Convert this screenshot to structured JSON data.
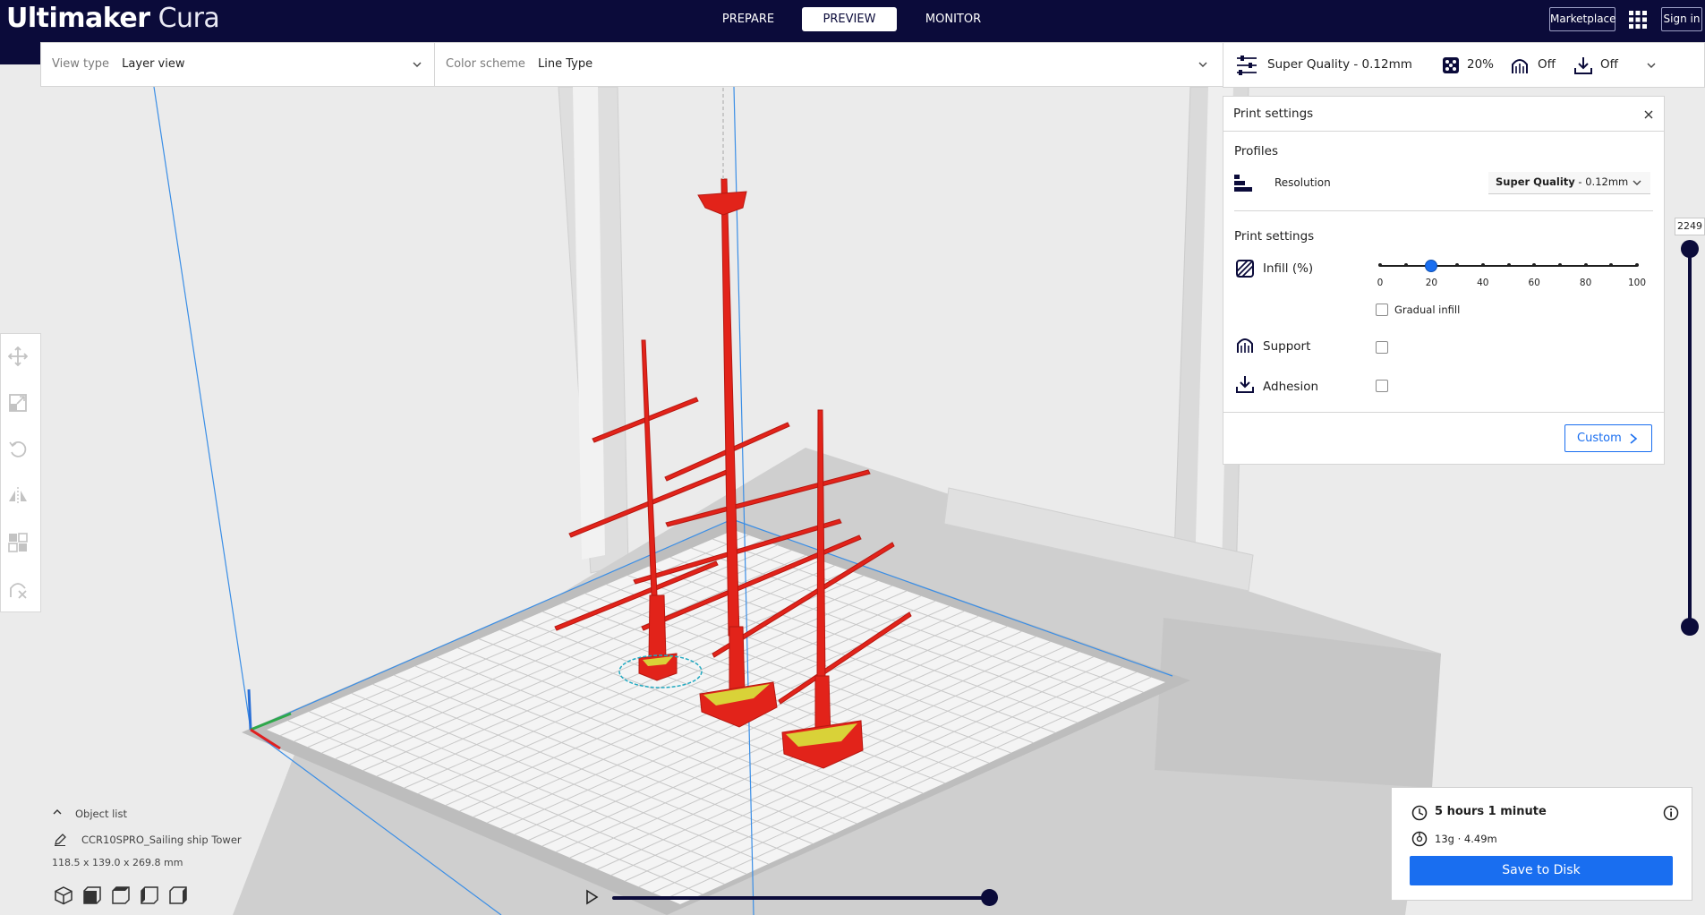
{
  "app": {
    "name_bold": "Ultimaker",
    "name_thin": "Cura"
  },
  "stages": [
    {
      "label": "PREPARE"
    },
    {
      "label": "PREVIEW"
    },
    {
      "label": "MONITOR"
    }
  ],
  "header_buttons": {
    "marketplace": "Marketplace",
    "signin": "Sign in"
  },
  "view": {
    "view_type_label": "View type",
    "view_type_value": "Layer view",
    "color_scheme_label": "Color scheme",
    "color_scheme_value": "Line Type"
  },
  "print_header": {
    "profile": "Super Quality - 0.12mm",
    "infill": "20%",
    "support": "Off",
    "adhesion": "Off"
  },
  "print_settings": {
    "title": "Print settings",
    "profiles_heading": "Profiles",
    "resolution_label": "Resolution",
    "resolution_bold": "Super Quality",
    "resolution_rest": " - 0.12mm",
    "settings_heading": "Print settings",
    "infill_label": "Infill (%)",
    "infill_value": 20,
    "infill_ticks": [
      "0",
      "20",
      "40",
      "60",
      "80",
      "100"
    ],
    "gradual_label": "Gradual infill",
    "support_label": "Support",
    "adhesion_label": "Adhesion",
    "custom_label": "Custom"
  },
  "object_list": {
    "title": "Object list",
    "object_name": "CCR10SPRO_Sailing ship Tower",
    "dimensions": "118.5 x 139.0 x 269.8 mm"
  },
  "job": {
    "time": "5 hours 1 minute",
    "material": "13g · 4.49m",
    "save_label": "Save to Disk"
  },
  "layer": {
    "current": "2249"
  },
  "colors": {
    "topbar": "#0b0b3a",
    "accent": "#196ef0",
    "toolpath": "#e2231a",
    "infill": "#d9d238"
  }
}
